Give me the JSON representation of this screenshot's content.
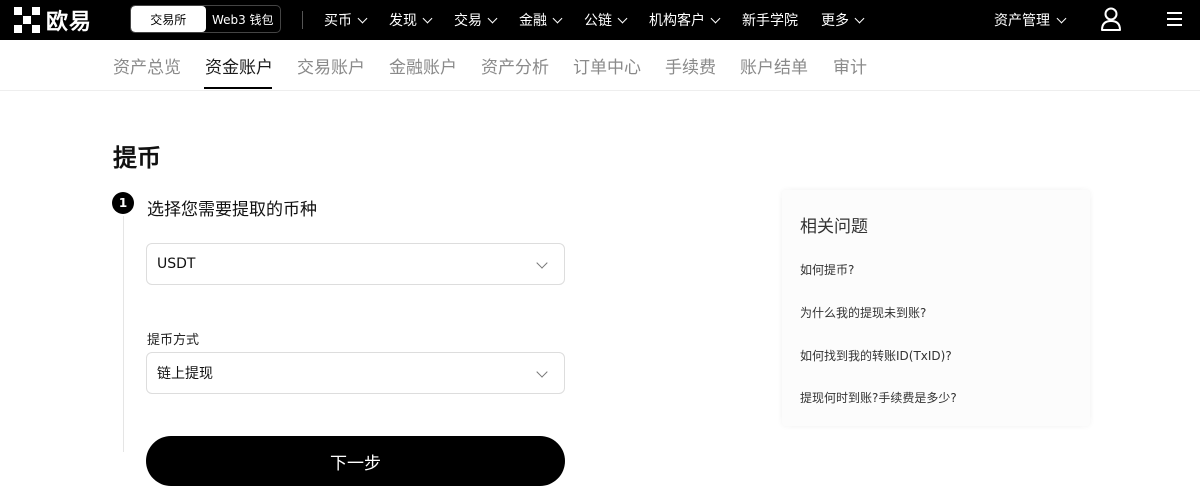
{
  "brand": {
    "name": "欧易"
  },
  "header": {
    "switcher": [
      {
        "label": "交易所",
        "active": true
      },
      {
        "label": "Web3 钱包",
        "active": false
      }
    ],
    "nav": [
      {
        "label": "买币",
        "dropdown": true
      },
      {
        "label": "发现",
        "dropdown": true
      },
      {
        "label": "交易",
        "dropdown": true
      },
      {
        "label": "金融",
        "dropdown": true
      },
      {
        "label": "公链",
        "dropdown": true
      },
      {
        "label": "机构客户",
        "dropdown": true
      },
      {
        "label": "新手学院",
        "dropdown": false
      },
      {
        "label": "更多",
        "dropdown": true
      }
    ],
    "asset_management": "资产管理",
    "icons": {
      "user": "user-icon",
      "menu": "hamburger-menu-icon"
    }
  },
  "subtabs": [
    {
      "label": "资产总览",
      "active": false
    },
    {
      "label": "资金账户",
      "active": true
    },
    {
      "label": "交易账户",
      "active": false
    },
    {
      "label": "金融账户",
      "active": false
    },
    {
      "label": "资产分析",
      "active": false
    },
    {
      "label": "订单中心",
      "active": false
    },
    {
      "label": "手续费",
      "active": false
    },
    {
      "label": "账户结单",
      "active": false
    },
    {
      "label": "审计",
      "active": false
    }
  ],
  "main": {
    "title": "提币",
    "step": {
      "number": "1",
      "title": "选择您需要提取的币种"
    },
    "coin_select": {
      "value": "USDT"
    },
    "method": {
      "label": "提币方式",
      "value": "链上提现"
    },
    "next_button": "下一步"
  },
  "faq": {
    "title": "相关问题",
    "links": [
      "如何提币?",
      "为什么我的提现未到账?",
      "如何找到我的转账ID(TxID)?",
      "提现何时到账?手续费是多少?"
    ]
  },
  "colors": {
    "topbar": "#000000",
    "primary_button": "#000000",
    "inactive_tab": "#8a8a8a"
  }
}
